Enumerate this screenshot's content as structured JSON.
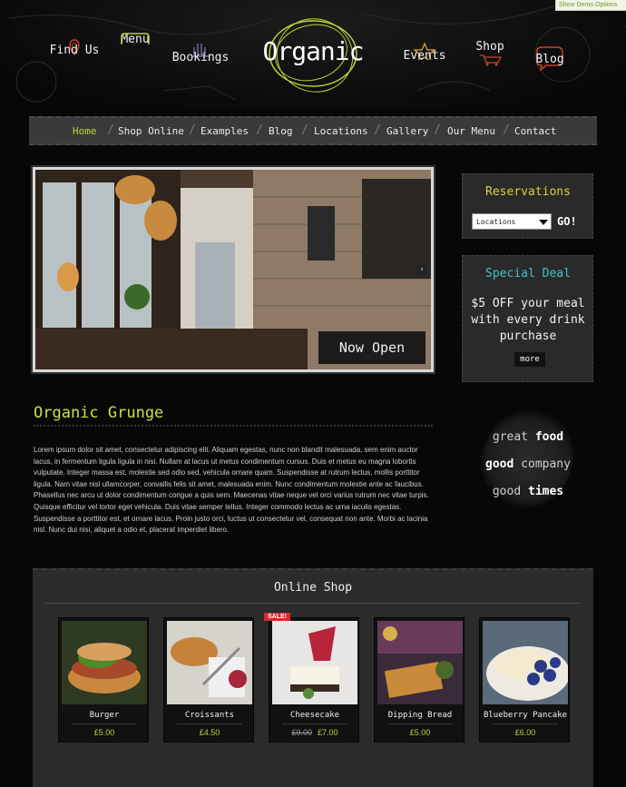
{
  "demo_options": {
    "label": "Show Demo Options"
  },
  "header": {
    "logo_text": "Organic",
    "nav": [
      {
        "label": "Find Us",
        "icon": "map-pin-icon"
      },
      {
        "label": "Menu",
        "icon": "menu-card-icon"
      },
      {
        "label": "Bookings",
        "icon": "hand-icon"
      },
      {
        "label": "Events",
        "icon": "star-icon"
      },
      {
        "label": "Shop",
        "icon": "cart-icon"
      },
      {
        "label": "Blog",
        "icon": "speech-bubble-icon"
      }
    ]
  },
  "navbar": {
    "items": [
      "Home",
      "Shop Online",
      "Examples",
      "Blog",
      "Locations",
      "Gallery",
      "Our Menu",
      "Contact"
    ],
    "active": "Home"
  },
  "slider": {
    "caption": "Now Open"
  },
  "sidebar": {
    "reservations": {
      "title": "Reservations",
      "select_value": "Locations",
      "go_label": "GO!"
    },
    "special_deal": {
      "title": "Special Deal",
      "text": "$5 OFF your meal with every drink purchase",
      "more_label": "more"
    },
    "slogan": {
      "line1": [
        "great",
        "food"
      ],
      "line2": [
        "good",
        "company"
      ],
      "line3": [
        "good",
        "times"
      ]
    }
  },
  "intro": {
    "title": "Organic Grunge",
    "text": "Lorem ipsum dolor sit amet, consectetur adipiscing elit. Aliquam egestas, nunc non blandit malesuada, sem enim auctor lacus, in fermentum ligula ligula in nisi. Nullam at lacus ut metus condimentum cursus. Duis et metus eu magna lobortis vulputate. Integer massa est, molestie sed odio sed, vehicula ornare quam. Suspendisse at rutrum lectus, mollis porttitor ligula. Nam vitae nisl ullamcorper, convallis felis sit amet, malesuada enim. Nunc condimentum molestie ante ac faucibus. Phasellus nec arcu ut dolor condimentum congue a quis sem. Maecenas vitae neque vel orci varius rutrum nec vitae turpis. Quisque efficitur vel tortor eget vehicula. Duis vitae semper tellus. Integer commodo lectus ac urna iaculis egestas. Suspendisse a porttitor est, et ornare lacus. Proin justo orci, luctus ut consectetur vel, consequat non ante. Morbi ac lacinia nisl. Nunc dui nisi, aliquet a odio et, placerat imperdiet libero."
  },
  "shop": {
    "title": "Online Shop",
    "products": [
      {
        "name": "Burger",
        "price": "£5.00",
        "old_price": "",
        "sale": ""
      },
      {
        "name": "Croissants",
        "price": "£4.50",
        "old_price": "",
        "sale": ""
      },
      {
        "name": "Cheesecake",
        "price": "£7.00",
        "old_price": "£9.00",
        "sale": "SALE!"
      },
      {
        "name": "Dipping Bread",
        "price": "£5.00",
        "old_price": "",
        "sale": ""
      },
      {
        "name": "Blueberry Pancake",
        "price": "£6.00",
        "old_price": "",
        "sale": ""
      }
    ]
  },
  "colors": {
    "accent_green": "#b7d33a",
    "accent_yellow": "#d9d23a",
    "accent_teal": "#41c3c8",
    "sale_red": "#d42a2a"
  }
}
